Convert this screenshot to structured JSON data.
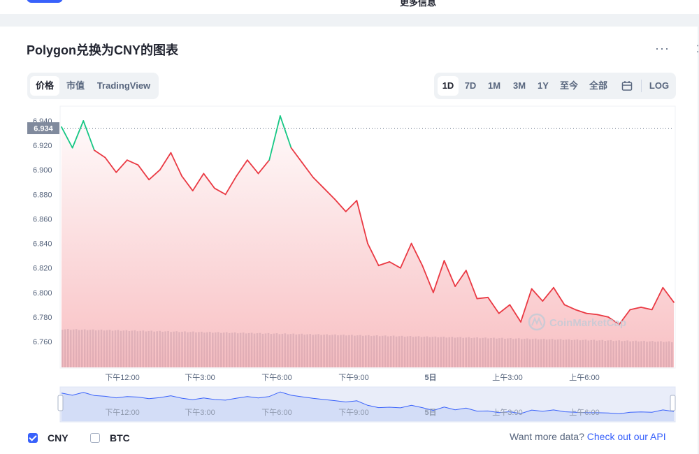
{
  "header": {
    "top_text": "更多信息"
  },
  "title": "Polygon兑换为CNY的图表",
  "more_label": "···",
  "data_tabs": [
    {
      "label": "价格",
      "active": true
    },
    {
      "label": "市值",
      "active": false
    },
    {
      "label": "TradingView",
      "active": false
    }
  ],
  "range_tabs": [
    {
      "label": "1D",
      "active": true
    },
    {
      "label": "7D",
      "active": false
    },
    {
      "label": "1M",
      "active": false
    },
    {
      "label": "3M",
      "active": false
    },
    {
      "label": "1Y",
      "active": false
    },
    {
      "label": "至今",
      "active": false
    },
    {
      "label": "全部",
      "active": false
    }
  ],
  "calendar_icon": "calendar-icon",
  "log_label": "LOG",
  "current_price_label": "6.934",
  "watermark": "CoinMarketCap",
  "colors": {
    "line_down": "#ea3943",
    "line_up": "#16c784",
    "accent": "#3861fb",
    "volume": "#dde1e8",
    "navigator_line": "#3861fb"
  },
  "chart_data": {
    "type": "line",
    "title": "",
    "ylim": [
      6.75,
      6.95
    ],
    "y_ticks": [
      "6.940",
      "6.920",
      "6.900",
      "6.880",
      "6.860",
      "6.840",
      "6.820",
      "6.800",
      "6.780",
      "6.760"
    ],
    "x_ticks": [
      "下午12:00",
      "下午3:00",
      "下午6:00",
      "下午9:00",
      "5日",
      "上午3:00",
      "上午6:00"
    ],
    "x": [
      0,
      0.5,
      1,
      1.5,
      2,
      2.5,
      3,
      3.5,
      4,
      4.5,
      5,
      5.5,
      6,
      6.5,
      7,
      7.5,
      8,
      8.5,
      9,
      9.5,
      10,
      10.5,
      11,
      11.5,
      12,
      12.5,
      13,
      13.5,
      14,
      14.5,
      15,
      15.5,
      16,
      16.5,
      17,
      17.5,
      18,
      18.5,
      19,
      19.5,
      20,
      20.5,
      21,
      21.5,
      22,
      22.5,
      23,
      23.5,
      24
    ],
    "series": [
      {
        "values": [
          6.935,
          6.918,
          6.94,
          6.916,
          6.91,
          6.898,
          6.908,
          6.904,
          6.892,
          6.9,
          6.914,
          6.895,
          6.883,
          6.897,
          6.885,
          6.88,
          6.895,
          6.908,
          6.897,
          6.908,
          6.944,
          6.918,
          6.906,
          6.894,
          6.885,
          6.876,
          6.866,
          6.875,
          6.84,
          6.822,
          6.825,
          6.82,
          6.84,
          6.822,
          6.8,
          6.826,
          6.805,
          6.818,
          6.795,
          6.796,
          6.783,
          6.79,
          6.776,
          6.803,
          6.793,
          6.804,
          6.79,
          6.786,
          6.783,
          6.782,
          6.78,
          6.774,
          6.786,
          6.788,
          6.786,
          6.804,
          6.792
        ]
      }
    ],
    "volume_band": "visible",
    "navigator": "visible",
    "grid": false,
    "legend": "bottom-left"
  },
  "legend": [
    {
      "label": "CNY",
      "checked": true
    },
    {
      "label": "BTC",
      "checked": false
    }
  ],
  "api_prompt": "Want more data?",
  "api_link": "Check out our API"
}
